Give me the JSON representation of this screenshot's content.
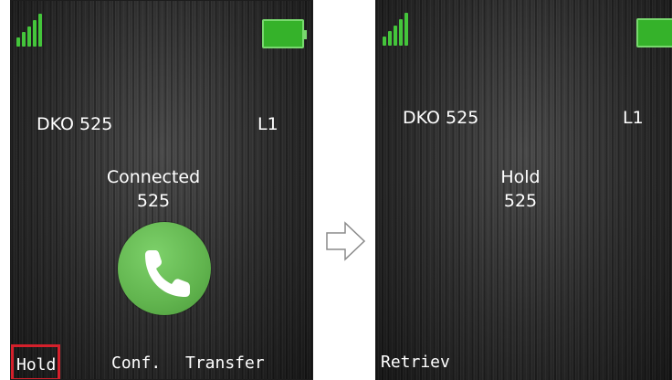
{
  "left_screen": {
    "line_name": "DKO 525",
    "line_id": "L1",
    "status": "Connected",
    "number": "525",
    "softkeys": {
      "left": "Hold",
      "middle": "Conf.",
      "right": "Transfer"
    },
    "icons": {
      "signal": "signal-strength-icon",
      "battery": "battery-full-icon",
      "call": "phone-connected-icon"
    }
  },
  "right_screen": {
    "line_name": "DKO 525",
    "line_id": "L1",
    "status": "Hold",
    "number": "525",
    "softkeys": {
      "left": "Retriev"
    },
    "icons": {
      "signal": "signal-strength-icon",
      "battery": "battery-full-icon"
    }
  },
  "transition_icon": "right-arrow-icon",
  "colors": {
    "accent_green": "#35b22a",
    "highlight_red": "#d4202b",
    "call_green": "#61b44e"
  }
}
